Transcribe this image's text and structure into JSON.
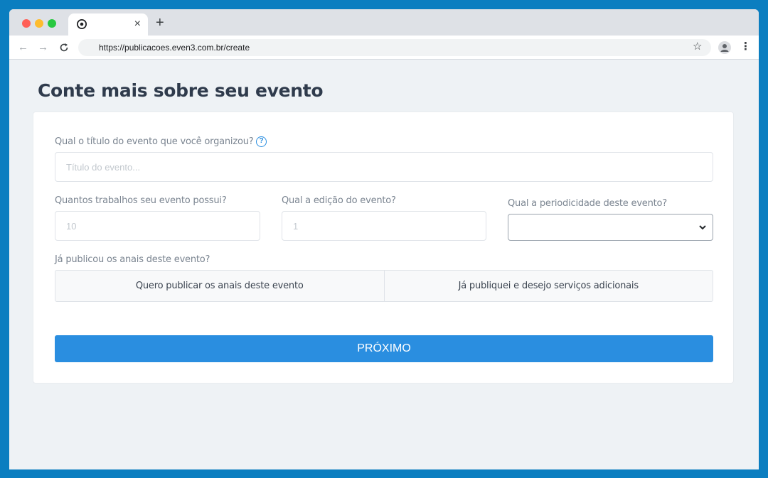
{
  "browser": {
    "url": "https://publicacoes.even3.com.br/create",
    "tab_close": "×",
    "new_tab": "+"
  },
  "page": {
    "title": "Conte mais sobre seu evento"
  },
  "form": {
    "title_question": "Qual o título do evento que você organizou?",
    "title_placeholder": "Título do evento...",
    "works_question": "Quantos trabalhos seu evento possui?",
    "works_placeholder": "10",
    "edition_question": "Qual a edição do evento?",
    "edition_placeholder": "1",
    "periodicity_question": "Qual a periodicidade deste evento?",
    "periodicity_value": "",
    "annals_question": "Já publicou os anais deste evento?",
    "option_publish": "Quero publicar os anais deste evento",
    "option_published": "Já publiquei e desejo serviços adicionais",
    "next_label": "PRÓXIMO"
  },
  "colors": {
    "accent": "#2a8ee0",
    "background": "#0b7ec0"
  }
}
